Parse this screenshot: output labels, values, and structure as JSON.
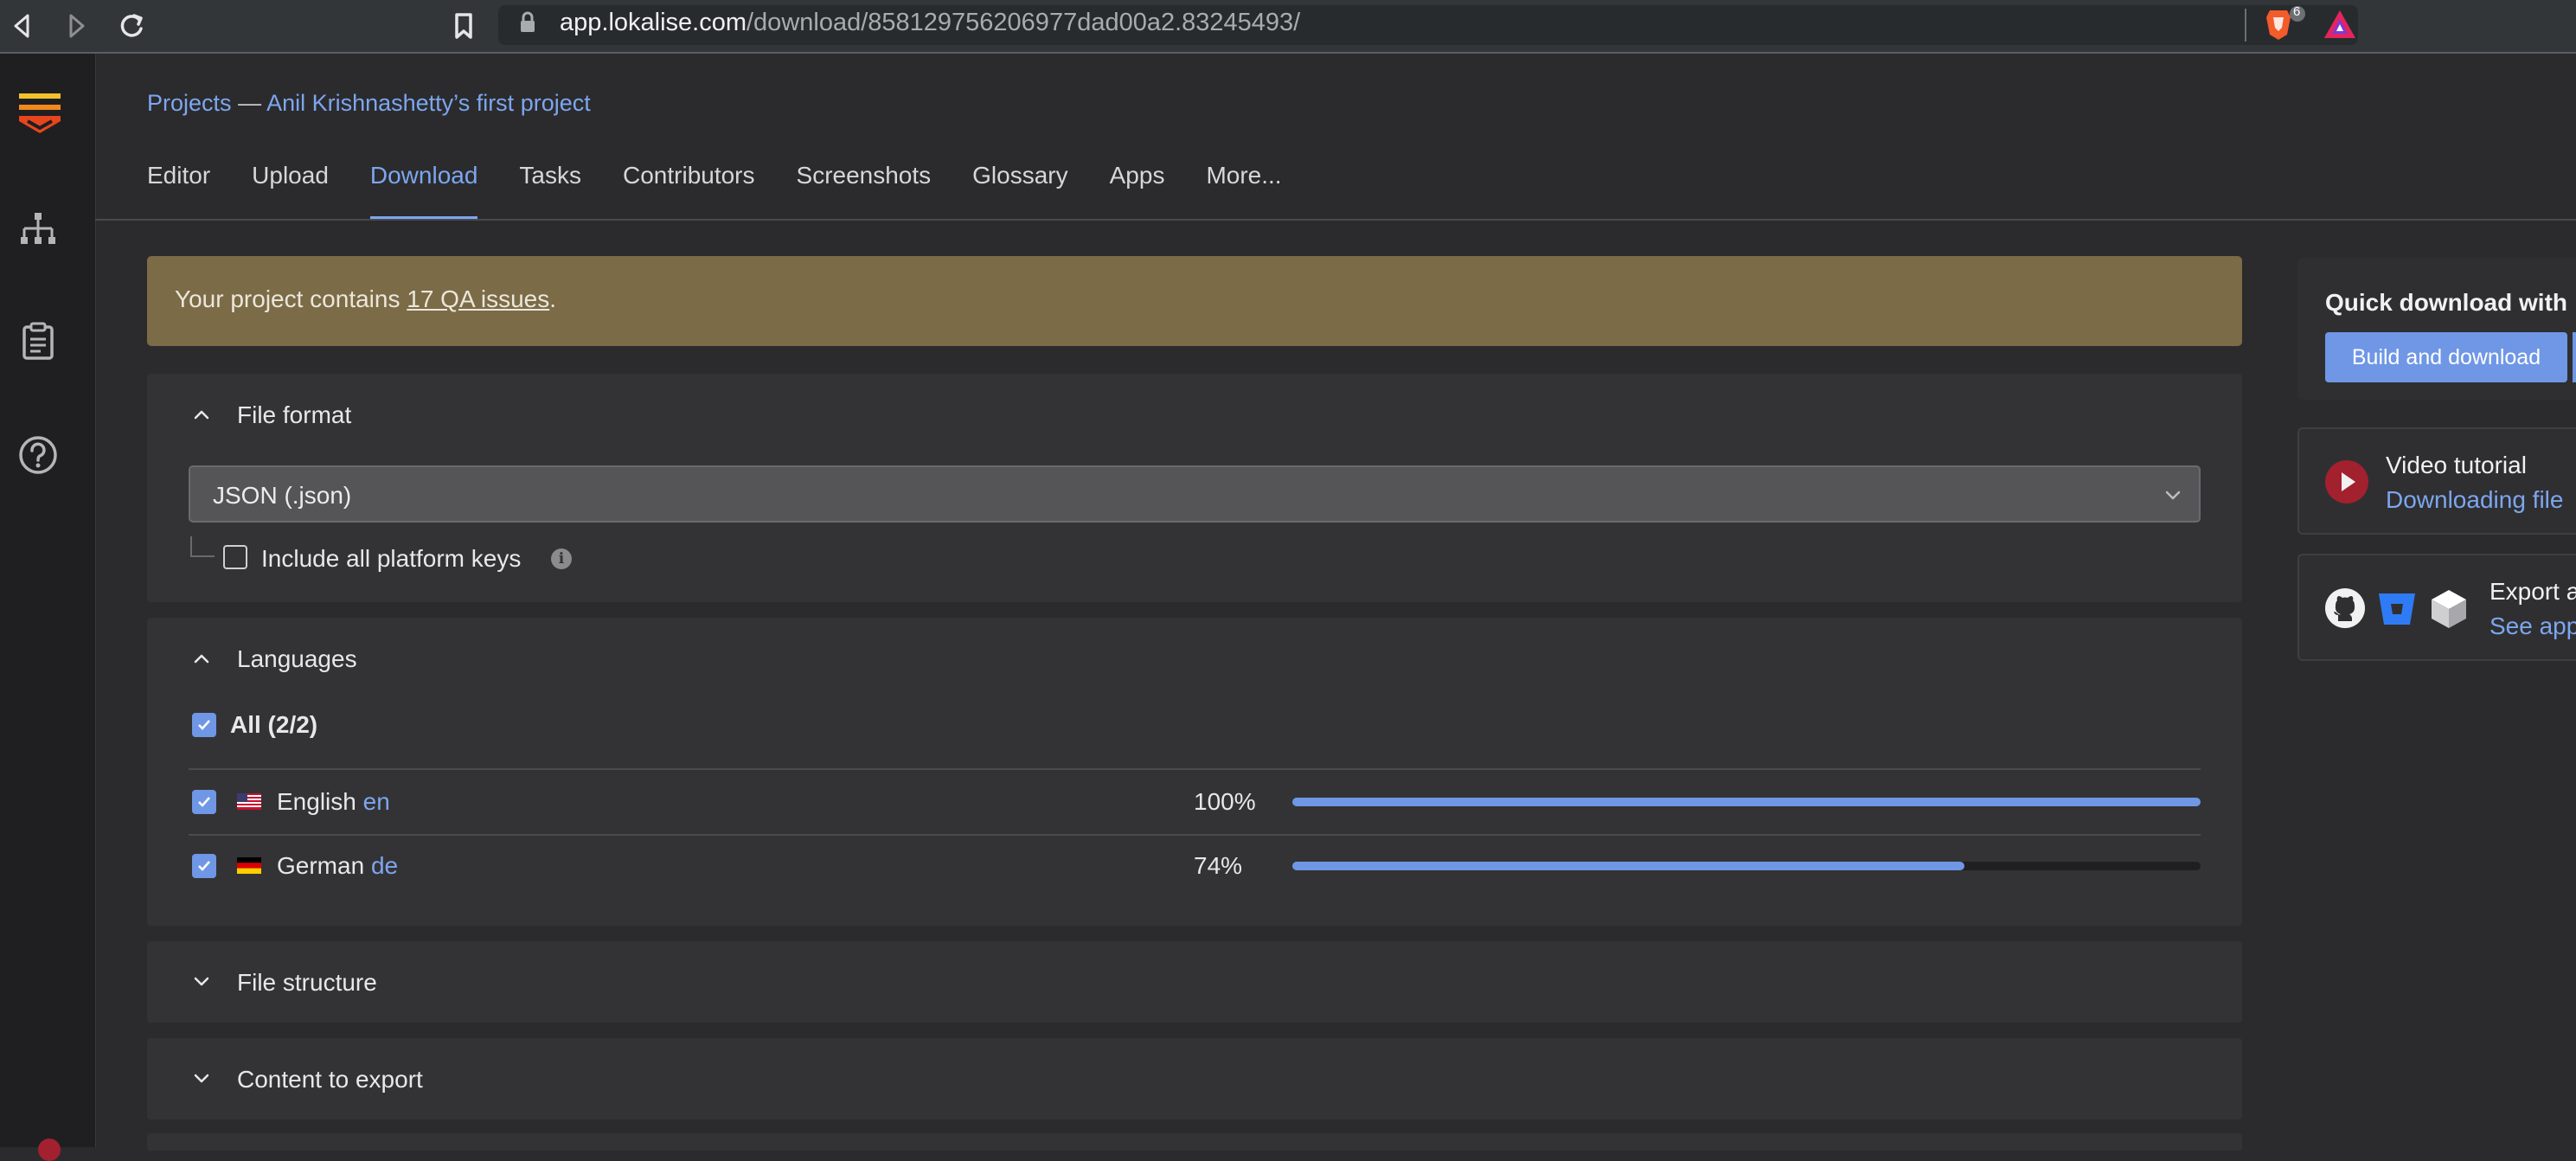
{
  "browser": {
    "url_host": "app.lokalise.com",
    "url_path": "/download/858129756206977dad00a2.83245493/",
    "brave_badge_count": "6"
  },
  "breadcrumb": {
    "projects": "Projects",
    "separator": "—",
    "project": "Anil Krishnashetty’s first project"
  },
  "tabs": [
    {
      "label": "Editor"
    },
    {
      "label": "Upload"
    },
    {
      "label": "Download"
    },
    {
      "label": "Tasks"
    },
    {
      "label": "Contributors"
    },
    {
      "label": "Screenshots"
    },
    {
      "label": "Glossary"
    },
    {
      "label": "Apps"
    },
    {
      "label": "More..."
    }
  ],
  "active_tab": "Download",
  "qa": {
    "prefix": "Your project contains ",
    "link": "17 QA issues",
    "suffix": "."
  },
  "file_format": {
    "title": "File format",
    "selected": "JSON (.json)",
    "include_platform_keys_label": "Include all platform keys",
    "include_platform_keys_checked": false
  },
  "languages": {
    "title": "Languages",
    "all_label": "All (2/2)",
    "items": [
      {
        "name": "English",
        "code": "en",
        "percent_label": "100%",
        "progress": 1.0,
        "checked": true
      },
      {
        "name": "German",
        "code": "de",
        "percent_label": "74%",
        "progress": 0.74,
        "checked": true
      }
    ]
  },
  "file_structure": {
    "title": "File structure"
  },
  "content_to_export": {
    "title": "Content to export"
  },
  "side": {
    "quick_download_title": "Quick download with",
    "build_button": "Build and download",
    "video_title": "Video tutorial",
    "video_link": "Downloading file",
    "export_title": "Export a",
    "export_link": "See app"
  },
  "colors": {
    "accent": "#6f97e6",
    "link": "#7da6ef",
    "qa_banner": "#7b6b47",
    "background": "#2b2b2d",
    "panel": "#333335"
  }
}
